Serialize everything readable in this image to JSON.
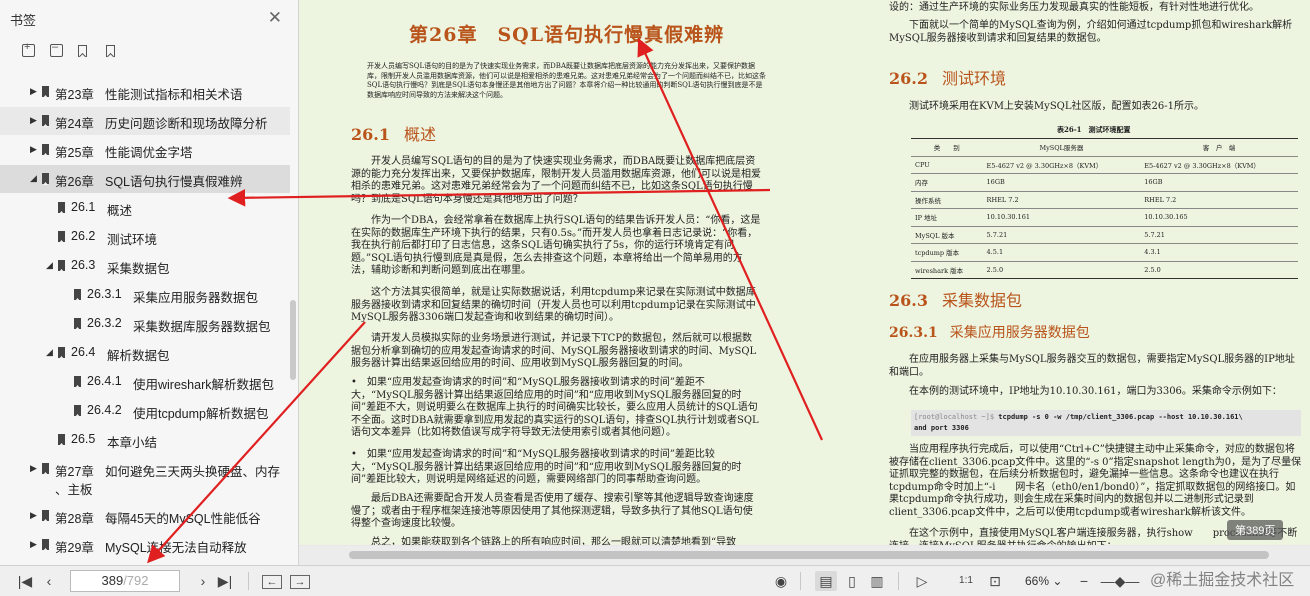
{
  "sidebar": {
    "title": "书签",
    "outline": [
      {
        "level": 0,
        "num": "第23章",
        "label": "性能测试指标和相关术语",
        "arrow": "▶",
        "state": ""
      },
      {
        "level": 0,
        "num": "第24章",
        "label": "历史问题诊断和现场故障分析",
        "arrow": "▶",
        "state": "hl"
      },
      {
        "level": 0,
        "num": "第25章",
        "label": "性能调优金字塔",
        "arrow": "▶",
        "state": ""
      },
      {
        "level": 0,
        "num": "第26章",
        "label": "SQL语句执行慢真假难辨",
        "arrow": "◢",
        "state": "sel"
      },
      {
        "level": 1,
        "num": "26.1",
        "label": "概述",
        "arrow": "",
        "state": ""
      },
      {
        "level": 1,
        "num": "26.2",
        "label": "测试环境",
        "arrow": "",
        "state": ""
      },
      {
        "level": 1,
        "num": "26.3",
        "label": "采集数据包",
        "arrow": "◢",
        "state": ""
      },
      {
        "level": 2,
        "num": "26.3.1",
        "label": "采集应用服务器数据包",
        "arrow": "",
        "state": ""
      },
      {
        "level": 2,
        "num": "26.3.2",
        "label": "采集数据库服务器数据包",
        "arrow": "",
        "state": ""
      },
      {
        "level": 1,
        "num": "26.4",
        "label": "解析数据包",
        "arrow": "◢",
        "state": ""
      },
      {
        "level": 2,
        "num": "26.4.1",
        "label": "使用wireshark解析数据包",
        "arrow": "",
        "state": ""
      },
      {
        "level": 2,
        "num": "26.4.2",
        "label": "使用tcpdump解析数据包",
        "arrow": "",
        "state": ""
      },
      {
        "level": 1,
        "num": "26.5",
        "label": "本章小结",
        "arrow": "",
        "state": ""
      },
      {
        "level": 0,
        "num": "第27章",
        "label": "如何避免三天两头换硬盘、内存",
        "label2": "、主板",
        "arrow": "▶",
        "state": ""
      },
      {
        "level": 0,
        "num": "第28章",
        "label": "每隔45天的MySQL性能低谷",
        "arrow": "▶",
        "state": ""
      },
      {
        "level": 0,
        "num": "第29章",
        "label": "MySQL连接无法自动释放",
        "arrow": "▶",
        "state": ""
      }
    ]
  },
  "doc": {
    "chapter_title": "第26章　SQL语句执行慢真假难辨",
    "chapter_abstract": "开发人员编写SQL语句的目的是为了快速实现业务需求，而DBA既要让数据库把底层资源的能力充分发挥出来，又要保护数据库，限制开发人员滥用数据库资源，他们可以说是相爱相杀的患难兄弟。这对患难兄弟经常会为了一个问题而纠结不已，比如这条SQL语句执行慢吗？到底是SQL语句本身慢还是其他地方出了问题？本章将介绍一种比较通用的判断SQL语句执行慢到底是不是数据库响应时间导致的方法来解决这个问题。",
    "s261_num": "26.1",
    "s261_title": "概述",
    "p1": "开发人员编写SQL语句的目的是为了快速实现业务需求，而DBA既要让数据库把底层资源的能力充分发挥出来，又要保护数据库，限制开发人员滥用数据库资源，他们可以说是相爱相杀的患难兄弟。这对患难兄弟经常会为了一个问题而纠结不已，比如这条SQL语句执行慢吗？到底是SQL语句本身慢还是其他地方出了问题？",
    "p2": "作为一个DBA，会经常拿着在数据库上执行SQL语句的结果告诉开发人员：“你看，这是在实际的数据库生产环境下执行的结果，只有0.5s。”而开发人员也拿着日志记录说：“你看，我在执行前后都打印了日志信息，这条SQL语句确实执行了5s，你的运行环境肯定有问题。”SQL语句执行慢到底是真是假，怎么去排查这个问题，本章将给出一个简单易用的方法，辅助诊断和判断问题到底出在哪里。",
    "p3": "这个方法其实很简单，就是让实际数据说话，利用tcpdump来记录在实际测试中数据库服务器接收到请求和回复结果的确切时间（开发人员也可以利用tcpdump记录在实际测试中MySQL服务器3306端口发起查询和收到结果的确切时间）。",
    "p4": "请开发人员模拟实际的业务场景进行测试，并记录下TCP的数据包，然后就可以根据数据包分析拿到确切的应用发起查询请求的时间、MySQL服务器接收到请求的时间、MySQL服务器计算出结果返回给应用的时间、应用收到MySQL服务器回复的时间。",
    "p5": "•　如果“应用发起查询请求的时间”和“MySQL服务器接收到请求的时间”差距不大，“MySQL服务器计算出结果返回给应用的时间”和“应用收到MySQL服务器回复的时间”差距不大，则说明要么在数据库上执行的时间确实比较长，要么应用人员统计的SQL语句不全面。这时DBA就需要拿到应用发起的真实运行的SQL语句，排查SQL执行计划或者SQL语句文本差异（比如将数值误写成字符导致无法使用索引或者其他问题）。",
    "p6": "•　如果“应用发起查询请求的时间”和“MySQL服务器接收到请求的时间”差距比较大，“MySQL服务器计算出结果返回给应用的时间”和“应用收到MySQL服务器回复的时间”差距比较大，则说明是网络延迟的问题，需要网络部门的同事帮助查询问题。",
    "p7": "最后DBA还需要配合开发人员查看是否使用了缓存、搜索引擎等其他逻辑导致查询速度慢了；或者由于程序框架连接池等原因使用了其他探测逻辑，导致多执行了其他SQL语句使得整个查询速度比较慢。",
    "p8": "总之，如果能获取到各个链路上的所有响应时间，那么一眼就可以清楚地看到“导致",
    "r_top": "设的：通过生产环境的实际业务压力发现最真实的性能短板，有针对性地进行优化。",
    "r_p1": "下面就以一个简单的MySQL查询为例，介绍如何通过tcpdump抓包和wireshark解析MySQL服务器接收到请求和回复结果的数据包。",
    "s262_num": "26.2",
    "s262_title": "测试环境",
    "r_p2": "测试环境采用在KVM上安装MySQL社区版，配置如表26-1所示。",
    "table_caption": "表26-1　测试环境配置",
    "table_headers": [
      "类　　别",
      "MySQL服务器",
      "客　户　端"
    ],
    "table_rows": [
      [
        "CPU",
        "E5-4627 v2 @ 3.30GHz×8（KVM）",
        "E5-4627 v2 @ 3.30GHz×8（KVM）"
      ],
      [
        "内存",
        "16GB",
        "16GB"
      ],
      [
        "操作系统",
        "RHEL 7.2",
        "RHEL 7.2"
      ],
      [
        "IP 地址",
        "10.10.30.161",
        "10.10.30.165"
      ],
      [
        "MySQL 版本",
        "5.7.21",
        "5.7.21"
      ],
      [
        "tcpdump 版本",
        "4.5.1",
        "4.3.1"
      ],
      [
        "wireshark 版本",
        "2.5.0",
        "2.5.0"
      ]
    ],
    "s263_num": "26.3",
    "s263_title": "采集数据包",
    "s2631_num": "26.3.1",
    "s2631_title": "采集应用服务器数据包",
    "r_p3": "在应用服务器上采集与MySQL服务器交互的数据包，需要指定MySQL服务器的IP地址和端口。",
    "r_p4": "在本例的测试环境中，IP地址为10.10.30.161，端口为3306。采集命令示例如下：",
    "code_prompt": "[root@localhost ~]$ ",
    "code_cmd": "tcpdump -s 0 -w /tmp/client_3306.pcap --host 10.10.30.161\\",
    "code_cmd2": "and port 3306",
    "r_p5": "当应用程序执行完成后，可以使用“Ctrl+C”快捷键主动中止采集命令，对应的数据包将被存储在client_3306.pcap文件中。这里的“-s 0”指定snapshot length为0，是为了尽量保证抓取完整的数据包，在后续分析数据包时，避免漏掉一些信息。这条命令也建议在执行tcpdump命令时加上“-i　　网卡名（eth0/en1/bond0）”，指定抓取数据包的网络接口。如果tcpdump命令执行成功，则会生成在采集时间内的数据包并以二进制形式记录到client_3306.pcap文件中，之后可以使用tcpdump或者wireshark解析该文件。",
    "r_p6": "在这个示例中，直接使用MySQL客户端连接服务器，执行show　　processlist等不断连接，连接MySQL服务器并执行命令的输出如下：",
    "page_badge": "第389页"
  },
  "toolbar": {
    "current_page": "389",
    "total_pages": "/792",
    "zoom": "66%",
    "watermark": "@稀土掘金技术社区"
  },
  "colors": {
    "heading": "#b9541b",
    "page_bg": "#edf5e0",
    "arrow": "#e02020"
  }
}
